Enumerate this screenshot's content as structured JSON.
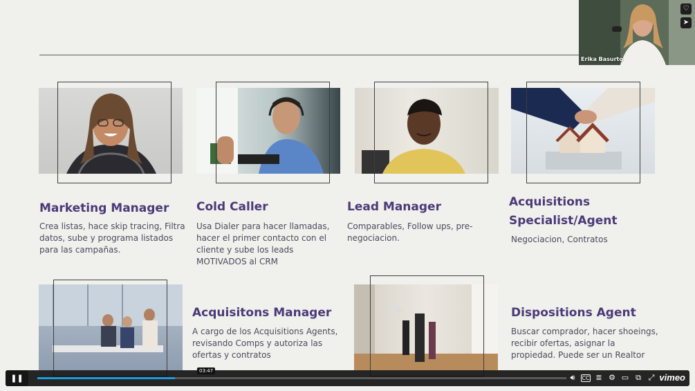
{
  "cards": [
    {
      "title": "Marketing Manager",
      "desc": "Crea listas, hace skip tracing, Filtra datos, sube y programa listados para las campañas."
    },
    {
      "title": "Cold Caller",
      "desc": "Usa Dialer para hacer llamadas, hacer el primer contacto con el cliente y sube los leads MOTIVADOS al CRM"
    },
    {
      "title": "Lead Manager",
      "desc": "Comparables, Follow ups, pre-negociacion."
    },
    {
      "title": "Acquisitions Specialist/Agent",
      "desc": "Negociacion, Contratos"
    },
    {
      "title": "Acquisitons Manager",
      "desc": "A cargo de los Acquisitions Agents, revisando Comps y autoriza las ofertas y contratos"
    },
    {
      "title": "Dispositions Agent",
      "desc": "Buscar comprador, hacer shoeings, recibir ofertas, asignar la propiedad. Puede ser un Realtor"
    }
  ],
  "webcam": {
    "name": "Erika Basurto"
  },
  "player": {
    "time_tooltip": "03:47",
    "progress": 0.26,
    "brand": "vimeo",
    "controls": [
      "volume-icon",
      "cc-icon",
      "transcript-icon",
      "settings-icon",
      "airplay-icon",
      "pip-icon",
      "fullscreen-icon"
    ]
  },
  "colors": {
    "title": "#4a3a78",
    "background": "#f0f0ec",
    "progress": "#1b9be0"
  }
}
